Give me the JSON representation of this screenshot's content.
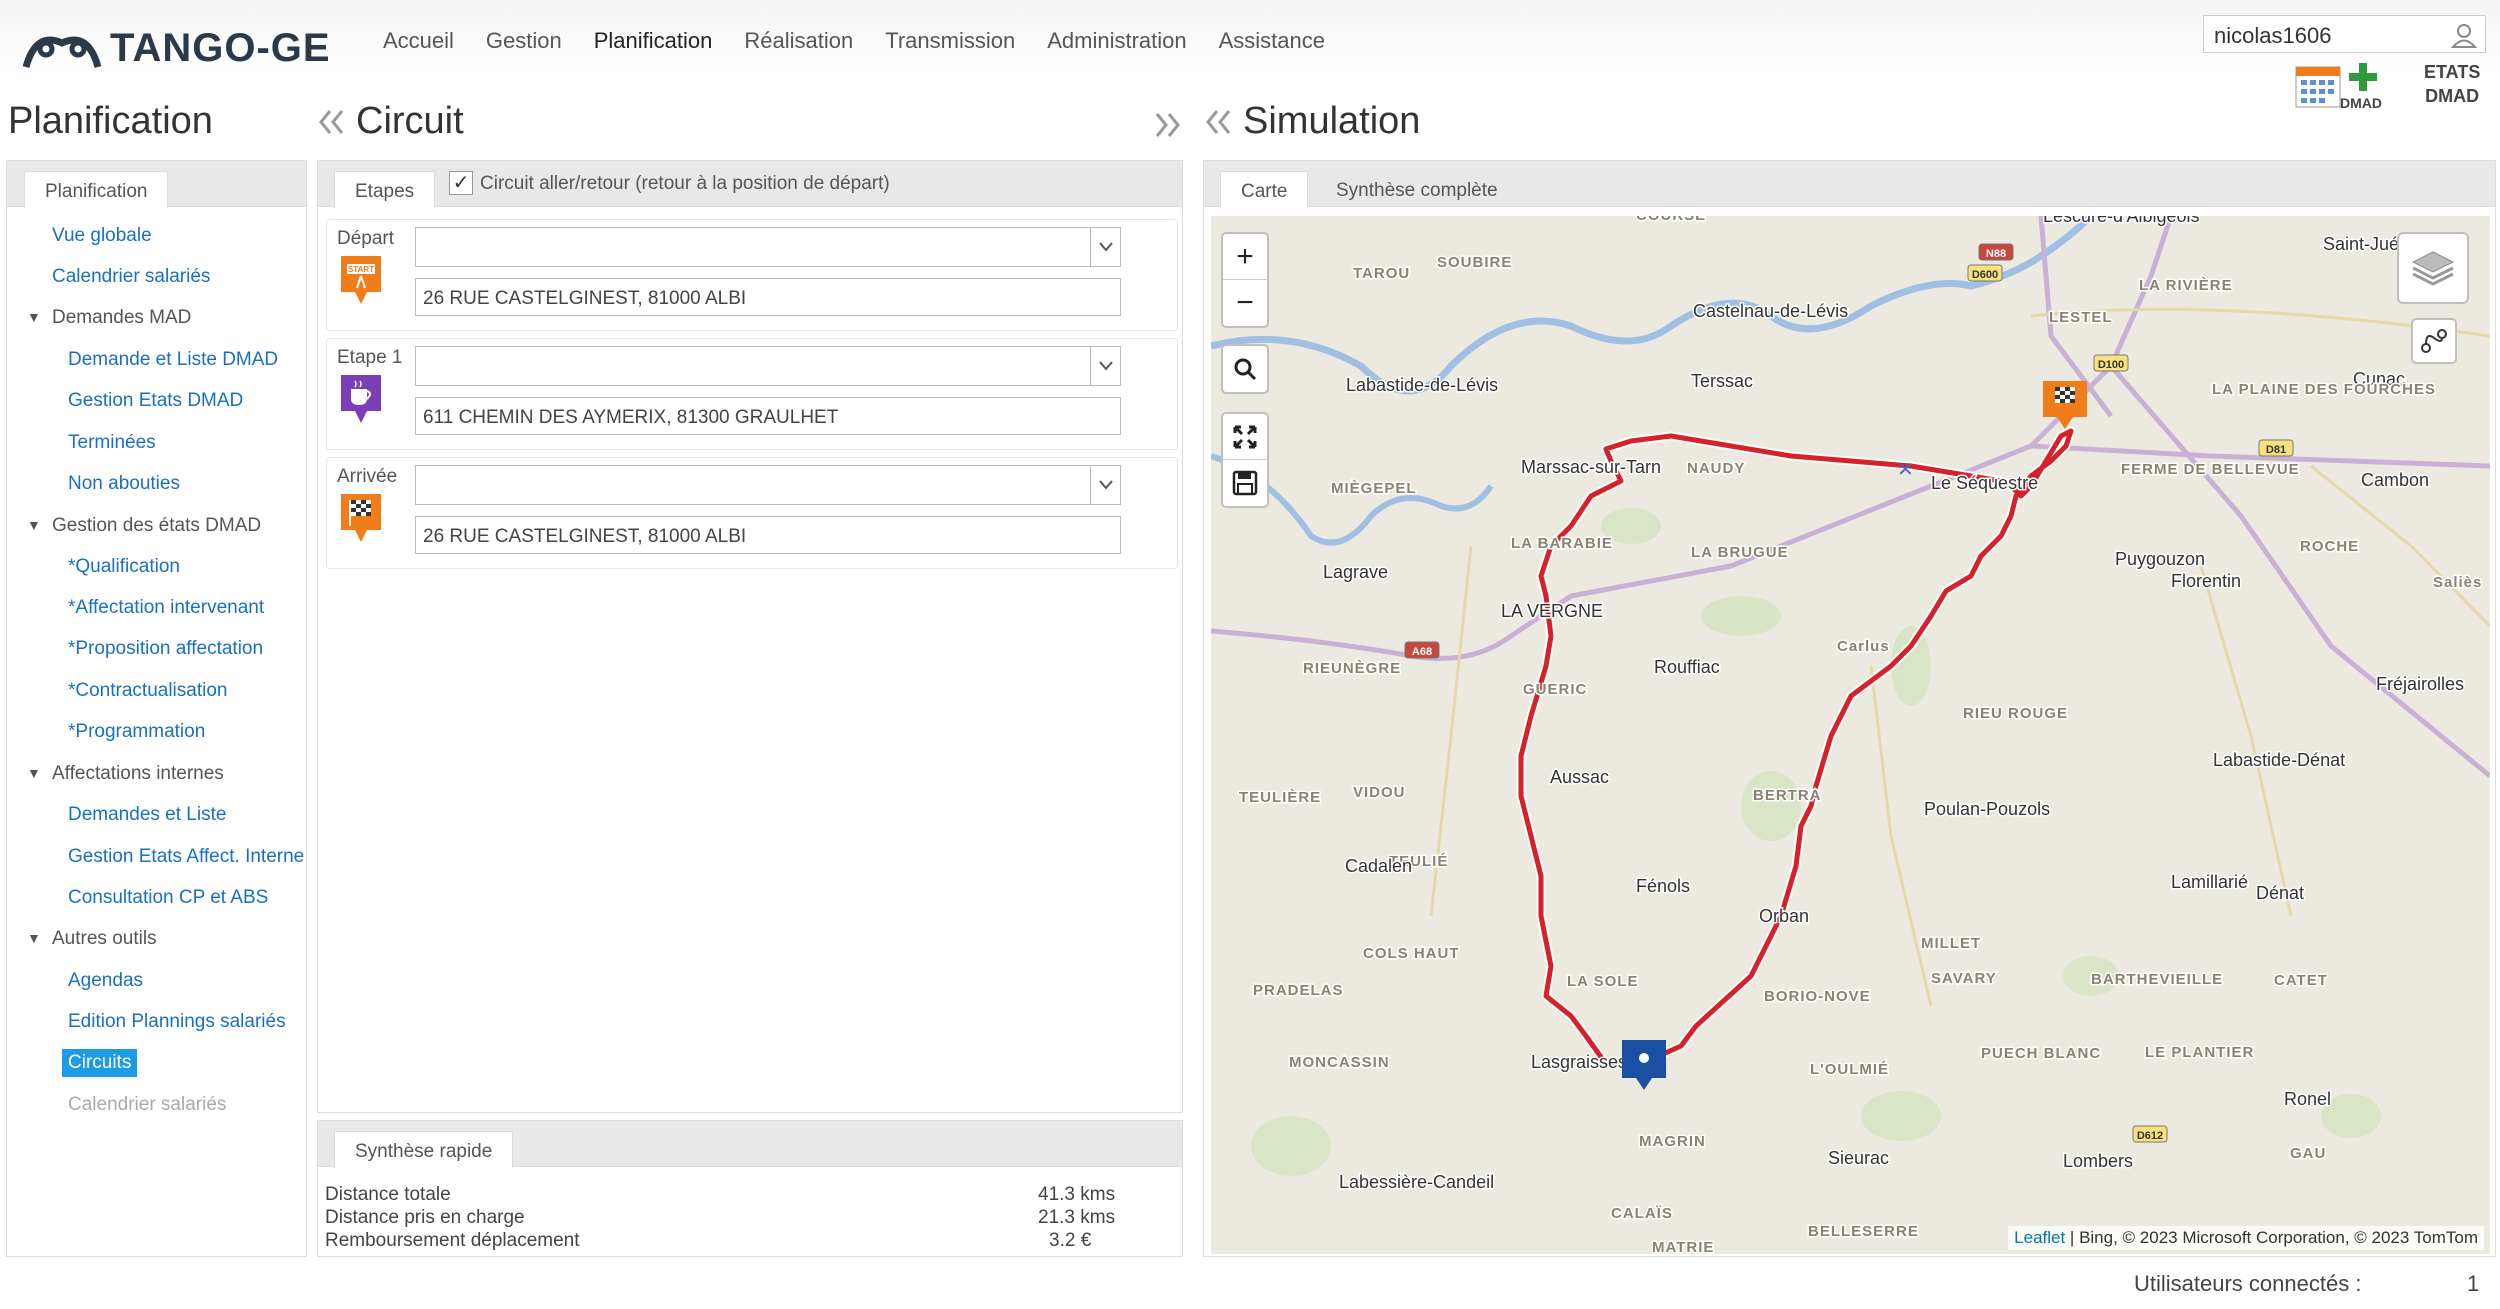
{
  "brand": {
    "name": "TANGO-GE"
  },
  "menu": [
    {
      "label": "Accueil"
    },
    {
      "label": "Gestion"
    },
    {
      "label": "Planification"
    },
    {
      "label": "Réalisation"
    },
    {
      "label": "Transmission"
    },
    {
      "label": "Administration"
    },
    {
      "label": "Assistance"
    }
  ],
  "user": {
    "name": "nicolas1606"
  },
  "toolbar": {
    "dmad_label": "DMAD",
    "etats_line1": "ETATS",
    "etats_line2": "DMAD"
  },
  "sections": {
    "planification": "Planification",
    "circuit": "Circuit",
    "simulation": "Simulation"
  },
  "left_panel": {
    "tab": "Planification",
    "items": [
      {
        "label": "Vue globale"
      },
      {
        "label": "Calendrier salariés"
      },
      {
        "label": "Demandes MAD"
      },
      {
        "label": "Demande et Liste DMAD"
      },
      {
        "label": "Gestion Etats DMAD"
      },
      {
        "label": "Terminées"
      },
      {
        "label": "Non abouties"
      },
      {
        "label": "Gestion des états DMAD"
      },
      {
        "label": "*Qualification"
      },
      {
        "label": "*Affectation intervenant"
      },
      {
        "label": "*Proposition affectation"
      },
      {
        "label": "*Contractualisation"
      },
      {
        "label": "*Programmation"
      },
      {
        "label": "Affectations internes"
      },
      {
        "label": "Demandes et Liste"
      },
      {
        "label": "Gestion Etats Affect. Internes"
      },
      {
        "label": "Consultation CP et ABS"
      },
      {
        "label": "Autres outils"
      },
      {
        "label": "Agendas"
      },
      {
        "label": "Edition Plannings salariés"
      },
      {
        "label": "Circuits"
      },
      {
        "label": "Calendrier salariés"
      }
    ]
  },
  "circuit": {
    "tab": "Etapes",
    "roundtrip_label": "Circuit aller/retour (retour à la position de départ)",
    "roundtrip_checked": true,
    "steps": [
      {
        "label": "Départ",
        "select_value": "",
        "address": "26 RUE CASTELGINEST, 81000 ALBI",
        "icon": "start-flag-icon",
        "color": "#f07d1a"
      },
      {
        "label": "Etape 1",
        "select_value": "",
        "address": "611 CHEMIN DES AYMERIX, 81300 GRAULHET",
        "icon": "coffee-cup-icon",
        "color": "#7a3fb8"
      },
      {
        "label": "Arrivée",
        "select_value": "",
        "address": "26 RUE CASTELGINEST, 81000 ALBI",
        "icon": "checkered-flag-icon",
        "color": "#f07d1a"
      }
    ],
    "summary": {
      "tab": "Synthèse rapide",
      "rows": [
        {
          "label": "Distance totale",
          "value": "41.3 kms"
        },
        {
          "label": "Distance pris en charge",
          "value": "21.3 kms"
        },
        {
          "label": "Remboursement déplacement",
          "value": "3.2 €"
        }
      ]
    }
  },
  "simulation": {
    "tabs": [
      {
        "label": "Carte"
      },
      {
        "label": "Synthèse complète"
      }
    ],
    "map": {
      "route_color": "#d6202a",
      "places": [
        "SOUBIRE",
        "TAROU",
        "Castelnau-de-Lévis",
        "LESTEL",
        "Lescure-d'Albigeois",
        "Saint-Juéry",
        "LA RIVIÈRE",
        "Labastide-de-Lévis",
        "Terssac",
        "Cunac",
        "LA PLAINE DES FOURCHES",
        "Marssac-sur-Tarn",
        "NAUDY",
        "Le Séquestre",
        "FERME DE BELLEVUE",
        "Cambon",
        "MIÈGEPEL",
        "Lagrave",
        "LA BARABIE",
        "LA BRUGUE",
        "Puygouzon",
        "ROCHE",
        "Florentin",
        "Saliès",
        "LA VERGNE",
        "RIEUNÈGRE",
        "Rouffiac",
        "Carlus",
        "Fréjairolles",
        "GUERIC",
        "RIEU ROUGE",
        "Labastide-Dénat",
        "Aussac",
        "VIDOU",
        "BERTRA",
        "Poulan-Pouzols",
        "TEULIÈRE",
        "TEULIÉ",
        "Cadalen",
        "Fénols",
        "Lamillarié",
        "Dénat",
        "Orban",
        "COLS HAUT",
        "MILLET",
        "LA SOLE",
        "PRADELAS",
        "BORIO-NOVE",
        "SAVARY",
        "BARTHEVIEILLE",
        "CATET",
        "MONCASSIN",
        "Lasgraisses",
        "PUECH BLANC",
        "L'OULMIÉ",
        "LE PLANTIER",
        "Ronel",
        "MAGRIN",
        "Sieurac",
        "Lombers",
        "GAU",
        "Labessière-Candeil",
        "CALAÏS",
        "BELLESERRE",
        "MATRIE",
        "COURSE"
      ],
      "roads": [
        "N88",
        "D600",
        "D100",
        "D612",
        "D81",
        "A68"
      ],
      "attribution_link": "Leaflet",
      "attribution_text": " | Bing, © 2023 Microsoft Corporation, © 2023 TomTom"
    }
  },
  "footer": {
    "label": "Utilisateurs connectés :",
    "count": "1"
  }
}
